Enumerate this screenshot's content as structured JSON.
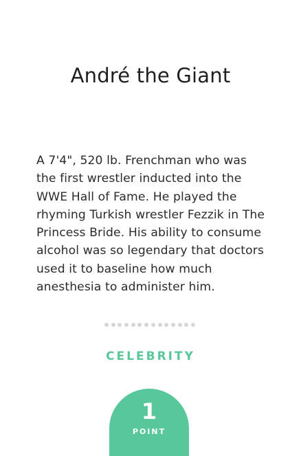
{
  "card": {
    "title": "André the Giant",
    "description": "A 7'4\", 520 lb. Frenchman who was the first wrestler inducted into the WWE Hall of Fame. He played the rhyming Turkish wrestler Fezzik in The Princess Bride. His ability to consume alcohol was so legendary that doctors used it to baseline how much anesthesia to administer him.",
    "category": "CELEBRITY",
    "points": {
      "value": "1",
      "label": "POINT"
    }
  },
  "colors": {
    "accent": "#58c79a",
    "dot": "#d7d7d7",
    "text": "#2b2b2b"
  }
}
